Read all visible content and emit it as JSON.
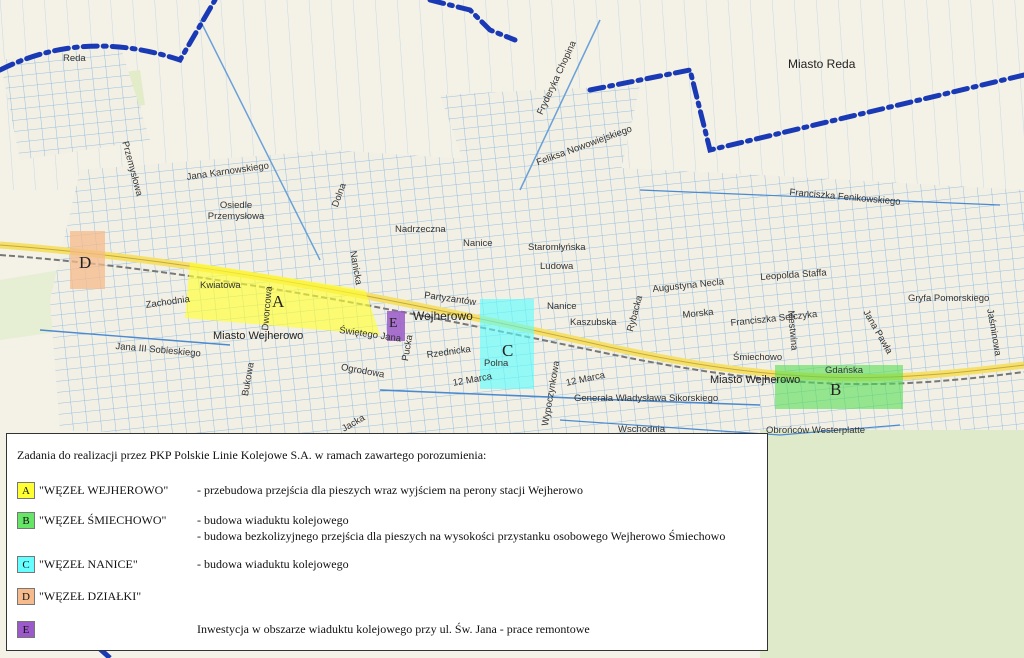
{
  "map": {
    "labels": {
      "reda_small": "Reda",
      "miasto_reda": "Miasto Reda",
      "chopina": "Fryderyka Chopina",
      "nowowiejskiego": "Feliksa Nowowiejskiego",
      "karnowskiego": "Jana Karnowskiego",
      "przemyslowa": "Przemysłowa",
      "osiedle": "Osiedle Przemysłowa",
      "fenikowskiego": "Franciszka Fenikowskiego",
      "dolna": "Dolna",
      "nadrzeczna": "Nadrzeczna",
      "nanice": "Nanice",
      "staromlynska": "Staromłyńska",
      "ludowa": "Ludowa",
      "augustyna_necla": "Augustyna Necla",
      "leopolda_staffa": "Leopolda Staffa",
      "gryfa": "Gryfa Pomorskiego",
      "kwiatowa": "Kwiatowa",
      "zachodnia": "Zachodnia",
      "miasto_wejherowo_w": "Miasto Wejherowo",
      "wejherowo": "Wejherowo",
      "jana_sobieskiego": "Jana III Sobieskiego",
      "partyzantow": "Partyzantów",
      "kaszubska": "Kaszubska",
      "nanice2": "Nanice",
      "morska": "Morska",
      "sefczyka": "Franciszka Sefczyka",
      "smiechowo": "Śmiechowo",
      "mestwina": "Mestwina",
      "jana_pawla": "Jana Pawła",
      "jazminowa": "Jaśminowa",
      "gdanska": "Gdańska",
      "miasto_wejherowo_e": "Miasto Wejherowo",
      "polna": "Polna",
      "marca12": "12 Marca",
      "marca12b": "12 Marca",
      "rzednicka": "Rzednicka",
      "sikorskiego": "Generała Władysława Sikorskiego",
      "wschodnia": "Wschodnia",
      "westerplatte": "Obrońców Westerplatte",
      "swietego_jana": "Świętego Jana",
      "bukowa": "Bukowa",
      "dworcowa": "Dworcowa",
      "puck": "Pucka",
      "rybacka": "Rybacka",
      "ogrodowa": "Ogrodowa",
      "nanicka": "Nanicka",
      "jacka": "Jacka",
      "wypoczynkowa": "Wypoczynkowa"
    },
    "zones": {
      "A": "A",
      "B": "B",
      "C": "C",
      "D": "D",
      "E": "E"
    }
  },
  "legend": {
    "title": "Zadania do realizacji przez PKP Polskie Linie Kolejowe S.A. w ramach zawartego porozumienia:",
    "items": [
      {
        "letter": "A",
        "color": "#ffff33",
        "name": "\"WĘZEŁ WEJHEROWO\"",
        "desc": "- przebudowa przejścia dla pieszych wraz wyjściem na perony stacji  Wejherowo",
        "desc2": ""
      },
      {
        "letter": "B",
        "color": "#66e666",
        "name": "\"WĘZEŁ ŚMIECHOWO\"",
        "desc": "- budowa wiaduktu kolejowego",
        "desc2": "- budowa bezkolizyjnego przejścia dla pieszych na wysokości przystanku osobowego Wejherowo Śmiechowo"
      },
      {
        "letter": "C",
        "color": "#66ffff",
        "name": "\"WĘZEŁ NANICE\"",
        "desc": "- budowa wiaduktu kolejowego",
        "desc2": ""
      },
      {
        "letter": "D",
        "color": "#f5bb8c",
        "name": "\"WĘZEŁ DZIAŁKI\"",
        "desc": "",
        "desc2": ""
      },
      {
        "letter": "E",
        "color": "#9b59c9",
        "name": "",
        "desc": "Inwestycja w obszarze wiaduktu kolejowego przy ul. Św. Jana - prace remontowe",
        "desc2": ""
      }
    ]
  }
}
